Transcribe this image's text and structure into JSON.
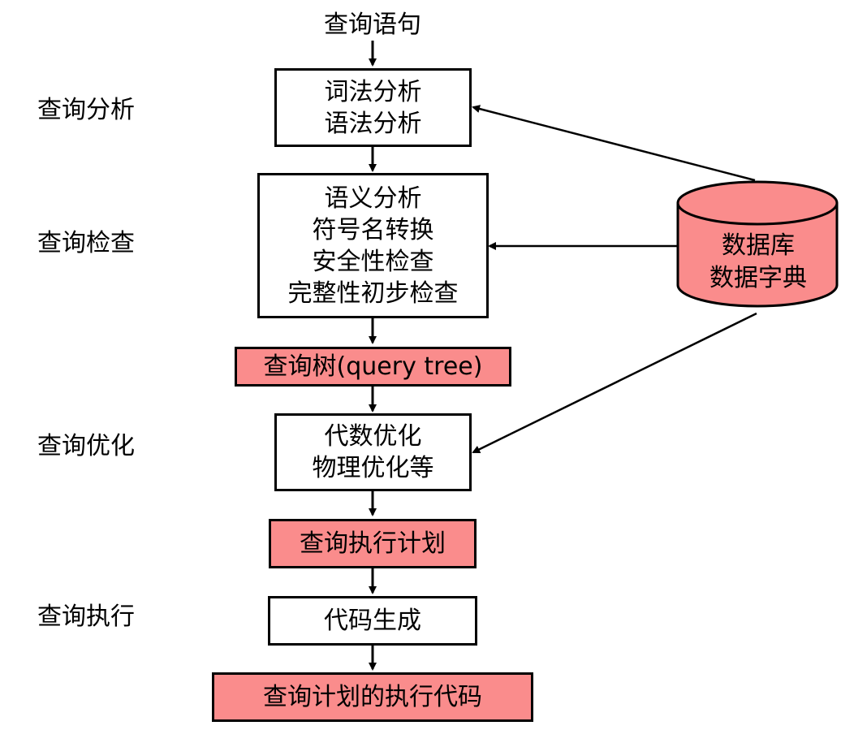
{
  "input_label": "查询语句",
  "stages": {
    "analysis": "查询分析",
    "check": "查询检查",
    "optimize": "查询优化",
    "execute": "查询执行"
  },
  "boxes": {
    "lexical": "词法分析",
    "syntax": "语法分析",
    "semantic": "语义分析",
    "symbol": "符号名转换",
    "security": "安全性检查",
    "integrity": "完整性初步检查",
    "query_tree": "查询树(query tree)",
    "algebra_opt": "代数优化",
    "physical_opt": "物理优化等",
    "exec_plan": "查询执行计划",
    "codegen": "代码生成",
    "exec_code": "查询计划的执行代码"
  },
  "database": {
    "line1": "数据库",
    "line2": "数据字典"
  },
  "colors": {
    "highlight_fill": "#fa8c8c",
    "border": "#000000"
  }
}
